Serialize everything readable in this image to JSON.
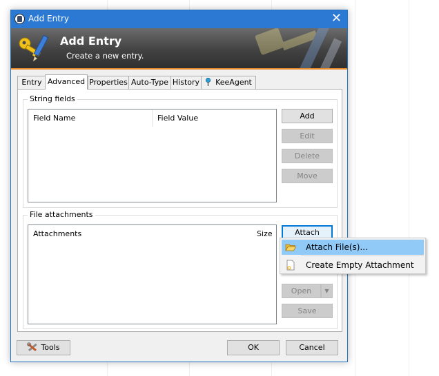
{
  "window": {
    "title": "Add Entry"
  },
  "banner": {
    "title": "Add Entry",
    "subtitle": "Create a new entry."
  },
  "tabs": [
    {
      "label": "Entry",
      "active": false
    },
    {
      "label": "Advanced",
      "active": true
    },
    {
      "label": "Properties",
      "active": false
    },
    {
      "label": "Auto-Type",
      "active": false
    },
    {
      "label": "History",
      "active": false
    },
    {
      "label": "KeeAgent",
      "active": false,
      "icon": "pin-icon"
    }
  ],
  "string_fields": {
    "group_label": "String fields",
    "columns": [
      "Field Name",
      "Field Value"
    ],
    "rows": [],
    "buttons": {
      "add": "Add",
      "edit": "Edit",
      "delete": "Delete",
      "move": "Move"
    }
  },
  "attachments": {
    "group_label": "File attachments",
    "columns": [
      "Attachments",
      "Size"
    ],
    "rows": [],
    "buttons": {
      "attach": "Attach",
      "open": "Open",
      "save": "Save"
    }
  },
  "attach_menu": {
    "items": [
      {
        "label": "Attach File(s)...",
        "icon": "folder-open-icon",
        "highlighted": true
      },
      {
        "label": "Create Empty Attachment",
        "icon": "new-file-icon",
        "highlighted": false
      }
    ]
  },
  "footer": {
    "tools": "Tools",
    "ok": "OK",
    "cancel": "Cancel"
  },
  "colors": {
    "titlebar": "#2b79d2",
    "banner_accent": "#e78b2c",
    "menu_highlight": "#91c9f7",
    "focus_border": "#0078d7"
  }
}
